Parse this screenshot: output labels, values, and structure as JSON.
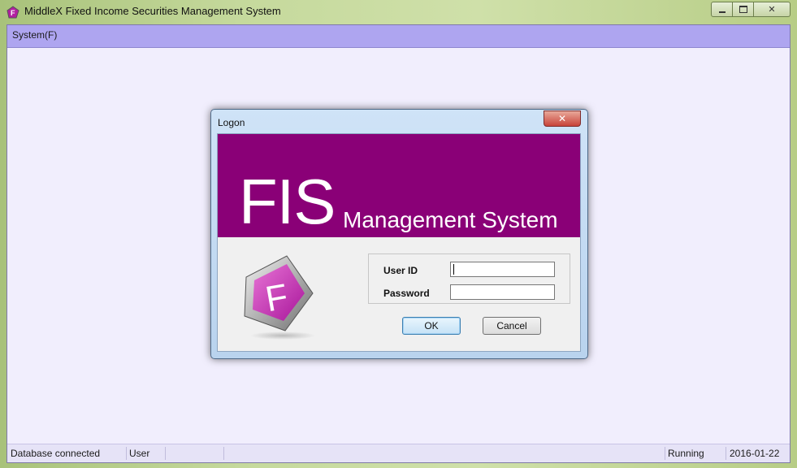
{
  "window": {
    "title": "MiddleX Fixed Income Securities Management System",
    "controls": [
      "minimize-icon",
      "maximize-icon",
      "close-icon"
    ]
  },
  "menu": {
    "items": [
      {
        "label": "System(F)"
      }
    ]
  },
  "dialog": {
    "title": "Logon",
    "banner": {
      "big_text": "FIS",
      "sub_text": "Management System",
      "color": "#8a0077"
    },
    "logo_letter": "F",
    "fields": {
      "user_id_label": "User ID",
      "user_id_value": "",
      "password_label": "Password",
      "password_value": ""
    },
    "buttons": {
      "ok": "OK",
      "cancel": "Cancel"
    }
  },
  "statusbar": {
    "db_status": "Database connected",
    "user": "User",
    "state": "Running",
    "date": "2016-01-22"
  },
  "colors": {
    "menubar": "#aea5f0",
    "client_bg": "#f1eefd",
    "frame": "#b9cf8a",
    "accent_magenta": "#8a0077"
  }
}
